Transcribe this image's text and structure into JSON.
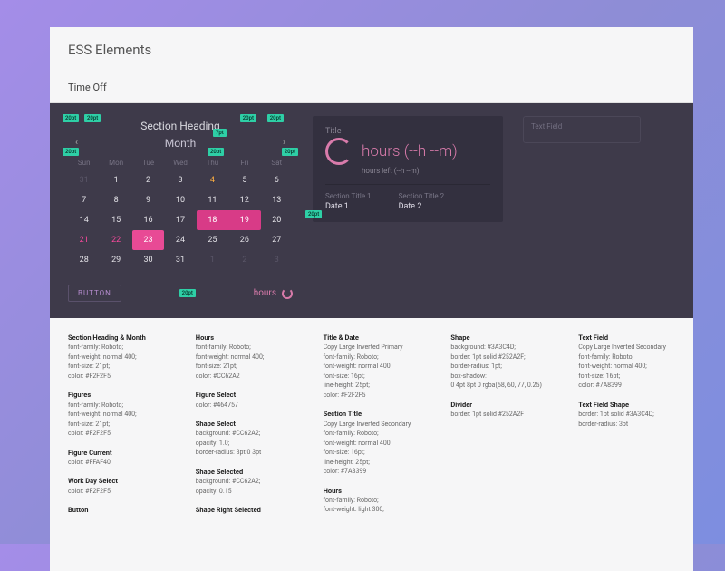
{
  "page_title": "ESS Elements",
  "section": "Time Off",
  "calendar": {
    "section_heading": "Section Heading",
    "month_label": "Month",
    "dow": [
      "Sun",
      "Mon",
      "Tue",
      "Wed",
      "Thu",
      "Fri",
      "Sat"
    ],
    "cells": [
      [
        31,
        1,
        2,
        3,
        4,
        5,
        6
      ],
      [
        7,
        8,
        9,
        10,
        11,
        12,
        13
      ],
      [
        14,
        15,
        16,
        17,
        18,
        19,
        20
      ],
      [
        21,
        22,
        23,
        24,
        25,
        26,
        27
      ],
      [
        28,
        29,
        30,
        31,
        1,
        2,
        3
      ]
    ],
    "button_label": "BUTTON",
    "hours_pill": "hours"
  },
  "card": {
    "title": "Title",
    "hours_label": "hours (--h --m)",
    "hours_left": "hours left (--h --m)",
    "section_title_1": "Section Title 1",
    "section_title_2": "Section Title 2",
    "date_1": "Date 1",
    "date_2": "Date 2"
  },
  "textfield_placeholder": "Text Field",
  "specs": {
    "col1": [
      {
        "t": "Section Heading & Month",
        "l": [
          "font-family: Roboto;",
          "font-weight: normal 400;",
          "font-size: 21pt;",
          "color: #F2F2F5"
        ]
      },
      {
        "t": "Figures",
        "l": [
          "font-family: Roboto;",
          "font-weight: normal 400;",
          "font-size: 21pt;",
          "color: #F2F2F5"
        ]
      },
      {
        "t": "Figure Current",
        "l": [
          "color: #FFAF40"
        ]
      },
      {
        "t": "Work Day Select",
        "l": [
          "color: #F2F2F5"
        ]
      },
      {
        "t": "Button",
        "l": []
      }
    ],
    "col2": [
      {
        "t": "Hours",
        "l": [
          "font-family: Roboto;",
          "font-weight: normal 400;",
          "font-size: 21pt;",
          "color: #CC62A2"
        ]
      },
      {
        "t": "Figure Select",
        "l": [
          "color: #464757"
        ]
      },
      {
        "t": "Shape Select",
        "l": [
          "background: #CC62A2;",
          "opacity: 1.0;",
          "border-radius: 3pt 0 3pt"
        ]
      },
      {
        "t": "Shape Selected",
        "l": [
          "background: #CC62A2;",
          "opacity: 0.15"
        ]
      },
      {
        "t": "Shape Right Selected",
        "l": []
      }
    ],
    "col3": [
      {
        "t": "Title & Date",
        "l": [
          "Copy Large Inverted Primary",
          "font-family: Roboto;",
          "font-weight: normal 400;",
          "font-size: 16pt;",
          "line-height: 25pt;",
          "color: #F2F2F5"
        ]
      },
      {
        "t": "Section Title",
        "l": [
          "Copy Large Inverted Secondary",
          "font-family: Roboto;",
          "font-weight: normal 400;",
          "font-size: 16pt;",
          "line-height: 25pt;",
          "color: #7A8399"
        ]
      },
      {
        "t": "Hours",
        "l": [
          "font-family: Roboto;",
          "font-weight: light 300;"
        ]
      }
    ],
    "col4": [
      {
        "t": "Shape",
        "l": [
          "background: #3A3C4D;",
          "border: 1pt solid #252A2F;",
          "border-radius: 1pt;",
          "box-shadow:",
          "0 4pt 8pt 0 rgba(58, 60, 77, 0.25)"
        ]
      },
      {
        "t": "Divider",
        "l": [
          "border: 1pt solid #252A2F"
        ]
      }
    ],
    "col5": [
      {
        "t": "Text Field",
        "l": [
          "Copy Large Inverted Secondary",
          "font-family: Roboto;",
          "font-weight: normal 400;",
          "font-size: 16pt;",
          "color: #7A8399"
        ]
      },
      {
        "t": "Text Field Shape",
        "l": [
          "border: 1pt solid #3A3C4D;",
          "border-radius: 3pt"
        ]
      }
    ]
  },
  "tags": {
    "t20a": "20pt",
    "t20b": "20pt",
    "t20c": "20pt",
    "t20d": "20pt",
    "t7a": "7pt",
    "t20e": "20pt",
    "t20f": "20pt",
    "t20g": "20pt",
    "t20h": "20pt"
  }
}
